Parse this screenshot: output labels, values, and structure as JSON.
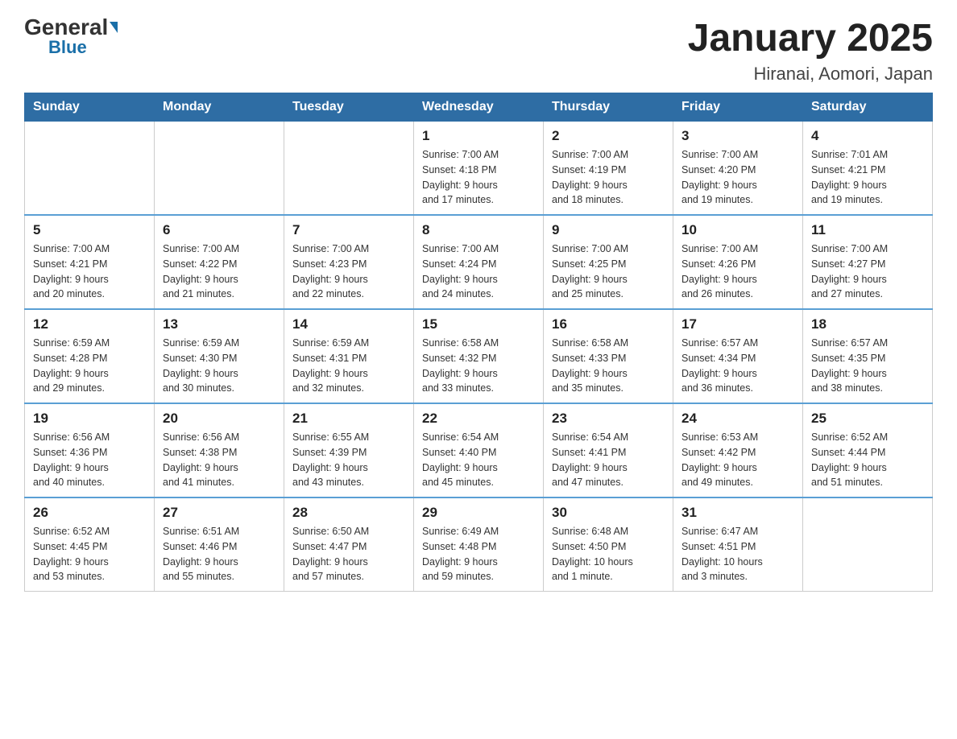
{
  "logo": {
    "general": "General",
    "blue": "Blue"
  },
  "title": "January 2025",
  "subtitle": "Hiranai, Aomori, Japan",
  "days_of_week": [
    "Sunday",
    "Monday",
    "Tuesday",
    "Wednesday",
    "Thursday",
    "Friday",
    "Saturday"
  ],
  "weeks": [
    [
      {
        "day": "",
        "info": ""
      },
      {
        "day": "",
        "info": ""
      },
      {
        "day": "",
        "info": ""
      },
      {
        "day": "1",
        "info": "Sunrise: 7:00 AM\nSunset: 4:18 PM\nDaylight: 9 hours\nand 17 minutes."
      },
      {
        "day": "2",
        "info": "Sunrise: 7:00 AM\nSunset: 4:19 PM\nDaylight: 9 hours\nand 18 minutes."
      },
      {
        "day": "3",
        "info": "Sunrise: 7:00 AM\nSunset: 4:20 PM\nDaylight: 9 hours\nand 19 minutes."
      },
      {
        "day": "4",
        "info": "Sunrise: 7:01 AM\nSunset: 4:21 PM\nDaylight: 9 hours\nand 19 minutes."
      }
    ],
    [
      {
        "day": "5",
        "info": "Sunrise: 7:00 AM\nSunset: 4:21 PM\nDaylight: 9 hours\nand 20 minutes."
      },
      {
        "day": "6",
        "info": "Sunrise: 7:00 AM\nSunset: 4:22 PM\nDaylight: 9 hours\nand 21 minutes."
      },
      {
        "day": "7",
        "info": "Sunrise: 7:00 AM\nSunset: 4:23 PM\nDaylight: 9 hours\nand 22 minutes."
      },
      {
        "day": "8",
        "info": "Sunrise: 7:00 AM\nSunset: 4:24 PM\nDaylight: 9 hours\nand 24 minutes."
      },
      {
        "day": "9",
        "info": "Sunrise: 7:00 AM\nSunset: 4:25 PM\nDaylight: 9 hours\nand 25 minutes."
      },
      {
        "day": "10",
        "info": "Sunrise: 7:00 AM\nSunset: 4:26 PM\nDaylight: 9 hours\nand 26 minutes."
      },
      {
        "day": "11",
        "info": "Sunrise: 7:00 AM\nSunset: 4:27 PM\nDaylight: 9 hours\nand 27 minutes."
      }
    ],
    [
      {
        "day": "12",
        "info": "Sunrise: 6:59 AM\nSunset: 4:28 PM\nDaylight: 9 hours\nand 29 minutes."
      },
      {
        "day": "13",
        "info": "Sunrise: 6:59 AM\nSunset: 4:30 PM\nDaylight: 9 hours\nand 30 minutes."
      },
      {
        "day": "14",
        "info": "Sunrise: 6:59 AM\nSunset: 4:31 PM\nDaylight: 9 hours\nand 32 minutes."
      },
      {
        "day": "15",
        "info": "Sunrise: 6:58 AM\nSunset: 4:32 PM\nDaylight: 9 hours\nand 33 minutes."
      },
      {
        "day": "16",
        "info": "Sunrise: 6:58 AM\nSunset: 4:33 PM\nDaylight: 9 hours\nand 35 minutes."
      },
      {
        "day": "17",
        "info": "Sunrise: 6:57 AM\nSunset: 4:34 PM\nDaylight: 9 hours\nand 36 minutes."
      },
      {
        "day": "18",
        "info": "Sunrise: 6:57 AM\nSunset: 4:35 PM\nDaylight: 9 hours\nand 38 minutes."
      }
    ],
    [
      {
        "day": "19",
        "info": "Sunrise: 6:56 AM\nSunset: 4:36 PM\nDaylight: 9 hours\nand 40 minutes."
      },
      {
        "day": "20",
        "info": "Sunrise: 6:56 AM\nSunset: 4:38 PM\nDaylight: 9 hours\nand 41 minutes."
      },
      {
        "day": "21",
        "info": "Sunrise: 6:55 AM\nSunset: 4:39 PM\nDaylight: 9 hours\nand 43 minutes."
      },
      {
        "day": "22",
        "info": "Sunrise: 6:54 AM\nSunset: 4:40 PM\nDaylight: 9 hours\nand 45 minutes."
      },
      {
        "day": "23",
        "info": "Sunrise: 6:54 AM\nSunset: 4:41 PM\nDaylight: 9 hours\nand 47 minutes."
      },
      {
        "day": "24",
        "info": "Sunrise: 6:53 AM\nSunset: 4:42 PM\nDaylight: 9 hours\nand 49 minutes."
      },
      {
        "day": "25",
        "info": "Sunrise: 6:52 AM\nSunset: 4:44 PM\nDaylight: 9 hours\nand 51 minutes."
      }
    ],
    [
      {
        "day": "26",
        "info": "Sunrise: 6:52 AM\nSunset: 4:45 PM\nDaylight: 9 hours\nand 53 minutes."
      },
      {
        "day": "27",
        "info": "Sunrise: 6:51 AM\nSunset: 4:46 PM\nDaylight: 9 hours\nand 55 minutes."
      },
      {
        "day": "28",
        "info": "Sunrise: 6:50 AM\nSunset: 4:47 PM\nDaylight: 9 hours\nand 57 minutes."
      },
      {
        "day": "29",
        "info": "Sunrise: 6:49 AM\nSunset: 4:48 PM\nDaylight: 9 hours\nand 59 minutes."
      },
      {
        "day": "30",
        "info": "Sunrise: 6:48 AM\nSunset: 4:50 PM\nDaylight: 10 hours\nand 1 minute."
      },
      {
        "day": "31",
        "info": "Sunrise: 6:47 AM\nSunset: 4:51 PM\nDaylight: 10 hours\nand 3 minutes."
      },
      {
        "day": "",
        "info": ""
      }
    ]
  ]
}
